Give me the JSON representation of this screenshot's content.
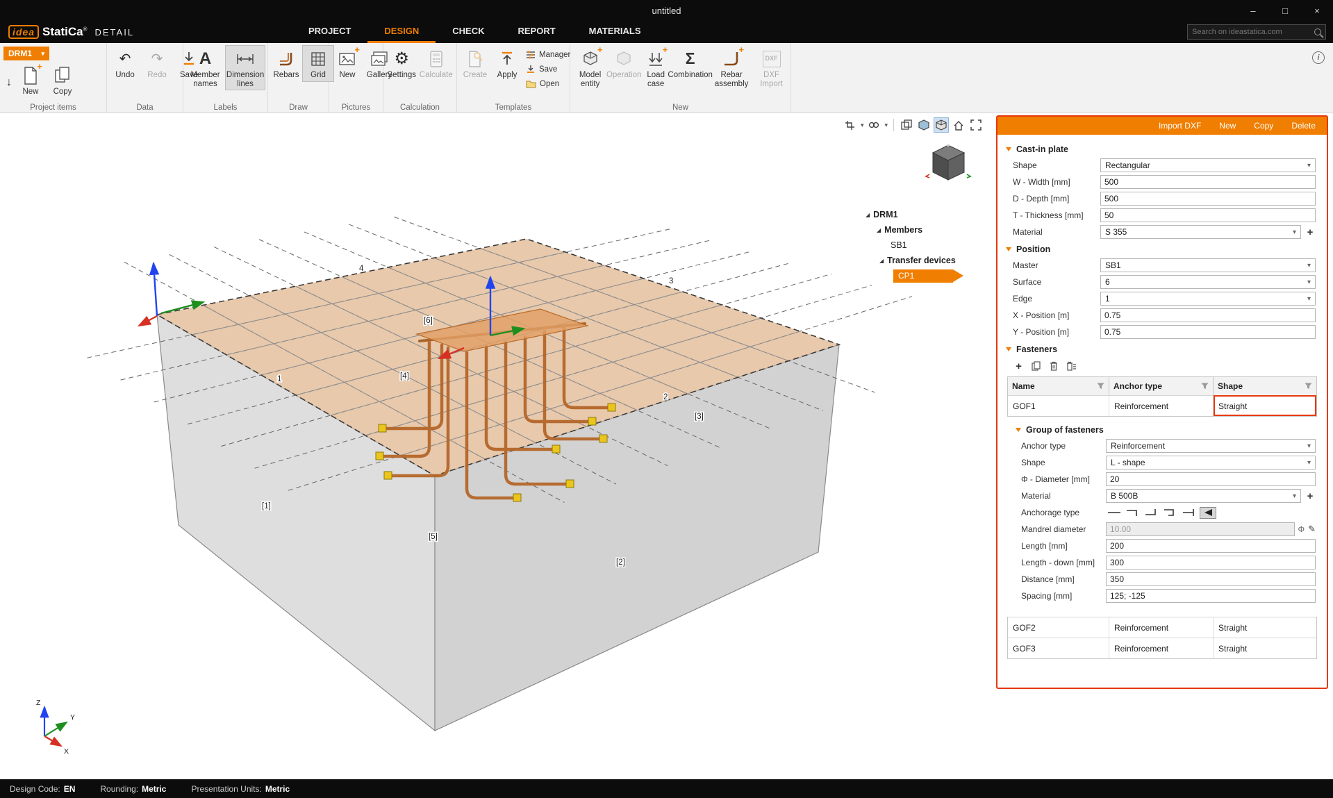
{
  "window": {
    "title": "untitled"
  },
  "icons": {
    "chevron_down": "▾",
    "arrow_down": "↓",
    "undo": "↶",
    "redo": "↷",
    "gear": "⚙",
    "sigma": "Σ",
    "letter_a": "A",
    "plus": "+",
    "info": "i",
    "pencil": "✎",
    "phi": "Φ",
    "tree_expanded": "◢",
    "minimize": "–",
    "maximize": "□",
    "close": "×",
    "dxf": "DXF"
  },
  "menubar": {
    "logo_idea": "idea",
    "logo_statica": "StatiCa",
    "logo_reg": "®",
    "module": "DETAIL",
    "items": [
      {
        "label": "PROJECT"
      },
      {
        "label": "DESIGN"
      },
      {
        "label": "CHECK"
      },
      {
        "label": "REPORT"
      },
      {
        "label": "MATERIALS"
      }
    ],
    "search_placeholder": "Search on ideastatica.com"
  },
  "ribbon": {
    "project_items": {
      "group_label": "Project items",
      "drm_button": "DRM1",
      "new_label": "New",
      "copy_label": "Copy"
    },
    "data": {
      "group_label": "Data",
      "undo": "Undo",
      "redo": "Redo",
      "save": "Save"
    },
    "labels": {
      "group_label": "Labels",
      "member_names": "Member names",
      "dimension_lines": "Dimension lines"
    },
    "draw": {
      "group_label": "Draw",
      "rebars": "Rebars",
      "grid": "Grid"
    },
    "pictures": {
      "group_label": "Pictures",
      "new": "New",
      "gallery": "Gallery"
    },
    "calculation": {
      "group_label": "Calculation",
      "settings": "Settings",
      "calculate": "Calculate"
    },
    "templates": {
      "group_label": "Templates",
      "create": "Create",
      "apply": "Apply",
      "manager": "Manager",
      "save": "Save",
      "open": "Open"
    },
    "new_group": {
      "group_label": "New",
      "model_entity": "Model entity",
      "operation": "Operation",
      "load_case": "Load case",
      "combination": "Combination",
      "rebar_assembly": "Rebar assembly",
      "dxf_import": "DXF Import"
    }
  },
  "viewport": {
    "tree": {
      "items": [
        {
          "label": "DRM1"
        },
        {
          "label": "Members"
        },
        {
          "label": "SB1"
        },
        {
          "label": "Transfer devices"
        },
        {
          "label": "CP1"
        }
      ]
    },
    "scene_labels": {
      "n4": "4",
      "n3": "3",
      "n1": "1",
      "n2": "2",
      "b1": "[1]",
      "b2": "[2]",
      "b3": "[3]",
      "b4": "[4]",
      "b5": "[5]",
      "b6": "[6]"
    },
    "axis": {
      "x": "X",
      "y": "Y",
      "z": "Z"
    }
  },
  "panel": {
    "header": {
      "import_dxf": "Import DXF",
      "new": "New",
      "copy": "Copy",
      "delete": "Delete"
    },
    "cast_in_plate": {
      "title": "Cast-in plate",
      "shape_label": "Shape",
      "shape_value": "Rectangular",
      "width_label": "W - Width [mm]",
      "width_value": "500",
      "depth_label": "D - Depth [mm]",
      "depth_value": "500",
      "thickness_label": "T - Thickness [mm]",
      "thickness_value": "50",
      "material_label": "Material",
      "material_value": "S 355"
    },
    "position": {
      "title": "Position",
      "master_label": "Master",
      "master_value": "SB1",
      "surface_label": "Surface",
      "surface_value": "6",
      "edge_label": "Edge",
      "edge_value": "1",
      "x_label": "X - Position [m]",
      "x_value": "0.75",
      "y_label": "Y - Position [m]",
      "y_value": "0.75"
    },
    "fasteners": {
      "title": "Fasteners",
      "table": {
        "headers": [
          "Name",
          "Anchor type",
          "Shape"
        ],
        "rows": [
          {
            "name": "GOF1",
            "anchor_type": "Reinforcement",
            "shape": "Straight"
          },
          {
            "name": "GOF2",
            "anchor_type": "Reinforcement",
            "shape": "Straight"
          },
          {
            "name": "GOF3",
            "anchor_type": "Reinforcement",
            "shape": "Straight"
          }
        ]
      },
      "group": {
        "title": "Group of fasteners",
        "anchor_type_label": "Anchor type",
        "anchor_type_value": "Reinforcement",
        "shape_label": "Shape",
        "shape_value": "L - shape",
        "diameter_label": "Φ - Diameter [mm]",
        "diameter_value": "20",
        "material_label": "Material",
        "material_value": "B 500B",
        "anchorage_label": "Anchorage type",
        "mandrel_label": "Mandrel diameter",
        "mandrel_value": "10.00",
        "length_label": "Length [mm]",
        "length_value": "200",
        "length_down_label": "Length - down [mm]",
        "length_down_value": "300",
        "distance_label": "Distance [mm]",
        "distance_value": "350",
        "spacing_label": "Spacing [mm]",
        "spacing_value": "125; -125"
      }
    }
  },
  "statusbar": {
    "design_code_label": "Design Code:",
    "design_code_value": "EN",
    "rounding_label": "Rounding:",
    "rounding_value": "Metric",
    "units_label": "Presentation Units:",
    "units_value": "Metric"
  },
  "colors": {
    "accent": "#f07e00",
    "selection": "#e8380d",
    "rebar": "#b5672a",
    "plate": "#e2a066"
  }
}
